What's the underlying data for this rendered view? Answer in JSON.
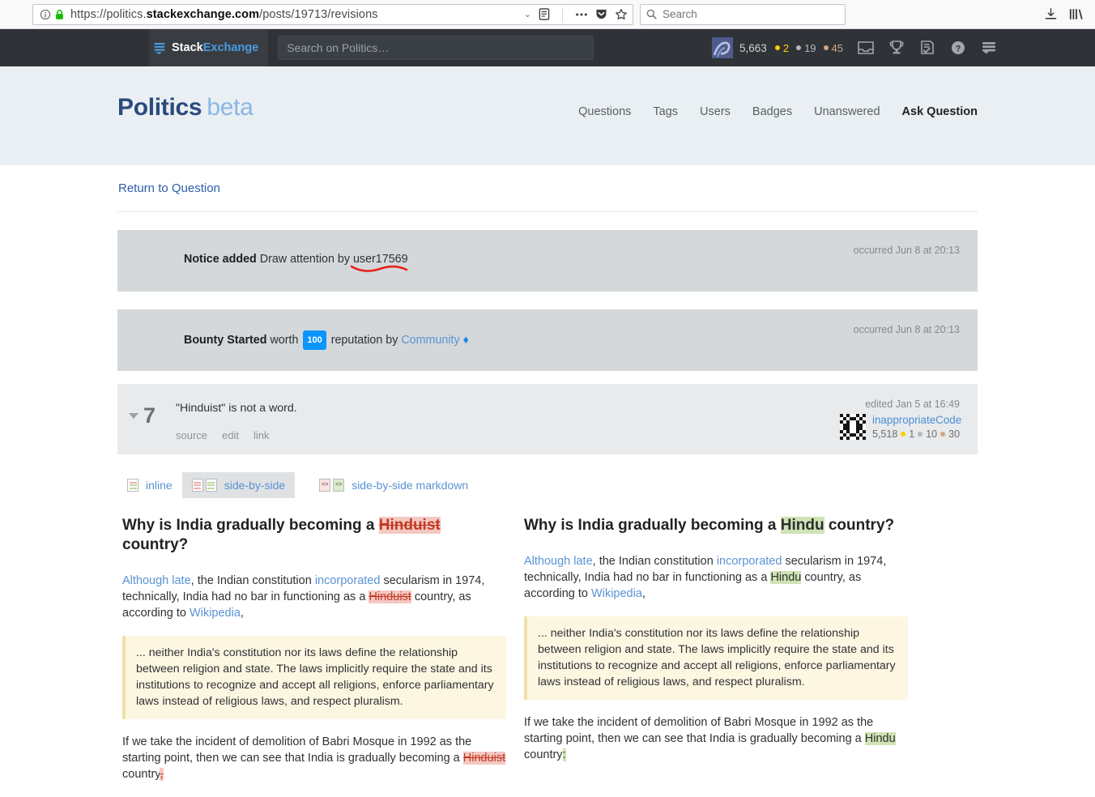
{
  "browser": {
    "url_prefix": "https://politics.",
    "url_domain": "stackexchange.com",
    "url_suffix": "/posts/19713/revisions",
    "search_placeholder": "Search",
    "icons": {
      "info": "info-icon",
      "lock": "padlock-icon",
      "reader": "reader-view-icon",
      "page_actions": "page-actions-icon",
      "pocket": "pocket-icon",
      "bookmark": "bookmark-star-icon",
      "downloads": "downloads-icon",
      "library": "library-icon"
    }
  },
  "se_topbar": {
    "logo_first": "Stack",
    "logo_second": "Exchange",
    "search_placeholder": "Search on Politics…",
    "reputation": "5,663",
    "gold": "2",
    "silver": "19",
    "bronze": "45",
    "icons": [
      "inbox-icon",
      "trophy-icon",
      "review-icon",
      "help-icon",
      "site-switcher-icon"
    ]
  },
  "site": {
    "title": "Politics",
    "beta": "beta",
    "nav": [
      {
        "label": "Questions",
        "strong": false
      },
      {
        "label": "Tags",
        "strong": false
      },
      {
        "label": "Users",
        "strong": false
      },
      {
        "label": "Badges",
        "strong": false
      },
      {
        "label": "Unanswered",
        "strong": false
      },
      {
        "label": "Ask Question",
        "strong": true
      }
    ]
  },
  "page": {
    "return_link": "Return to Question"
  },
  "revisions": [
    {
      "type": "notice",
      "title": "Notice added",
      "text": " Draw attention by ",
      "user": "user17569",
      "when": "occurred Jun 8 at 20:13",
      "annotated": true
    },
    {
      "type": "bounty",
      "title": "Bounty Started",
      "text_pre": " worth ",
      "amount": "100",
      "text_mid": " reputation by ",
      "user": "Community",
      "diamond": "♦",
      "when": "occurred Jun 8 at 20:13"
    }
  ],
  "revision_current": {
    "number": "7",
    "comment": "\"Hinduist\" is not a word.",
    "links": [
      "source",
      "edit",
      "link"
    ],
    "edited": "edited Jan 5 at 16:49",
    "user": "inappropriateCode",
    "user_rep": "5,518",
    "gold": "1",
    "silver": "10",
    "bronze": "30"
  },
  "diff_tabs": [
    {
      "label": "inline",
      "selected": false,
      "icon": "single-document-icon"
    },
    {
      "label": "side-by-side",
      "selected": true,
      "icon": "two-documents-icon"
    },
    {
      "label": "side-by-side markdown",
      "selected": false,
      "icon": "two-code-documents-icon"
    }
  ],
  "diff": {
    "left": {
      "title_pre": "Why is India gradually becoming a ",
      "title_change": "Hinduist",
      "title_post": " country?",
      "p1_a": "Although late",
      "p1_b": ", the Indian constitution ",
      "p1_c": "incorporated",
      "p1_d": " secularism in 1974, technically, India had no bar in functioning as a ",
      "p1_change": "Hinduist",
      "p1_e": " country, as according to ",
      "p1_f": "Wikipedia",
      "p1_g": ",",
      "quote": "... neither India's constitution nor its laws define the relationship between religion and state. The laws implicitly require the state and its institutions to recognize and accept all religions, enforce parliamentary laws instead of religious laws, and respect pluralism.",
      "p2_a": "If we take the incident of demolition of Babri Mosque in 1992 as the starting point, then we can see that India is gradually becoming a ",
      "p2_change": "Hinduist",
      "p2_b": " country",
      "p2_change2": ","
    },
    "right": {
      "title_pre": "Why is India gradually becoming a ",
      "title_change": "Hindu",
      "title_post": " country?",
      "p1_a": "Although late",
      "p1_b": ", the Indian constitution ",
      "p1_c": "incorporated",
      "p1_d": " secularism in 1974, technically, India had no bar in functioning as a ",
      "p1_change": "Hindu",
      "p1_e": " country, as according to ",
      "p1_f": "Wikipedia",
      "p1_g": ",",
      "quote": "... neither India's constitution nor its laws define the relationship between religion and state. The laws implicitly require the state and its institutions to recognize and accept all religions, enforce parliamentary laws instead of religious laws, and respect pluralism.",
      "p2_a": "If we take the incident of demolition of Babri Mosque in 1992 as the starting point, then we can see that India is gradually becoming a ",
      "p2_change": "Hindu",
      "p2_b": " country",
      "p2_change2": ":"
    }
  },
  "colors": {
    "se_dark": "#2f3337",
    "site_band": "#e9eff2",
    "link_blue": "#5a93d4",
    "deleted": "#f4c8c2",
    "inserted": "#cfe3b4",
    "bounty_blue": "#0a95ff",
    "annotation_red": "#e8231e"
  }
}
